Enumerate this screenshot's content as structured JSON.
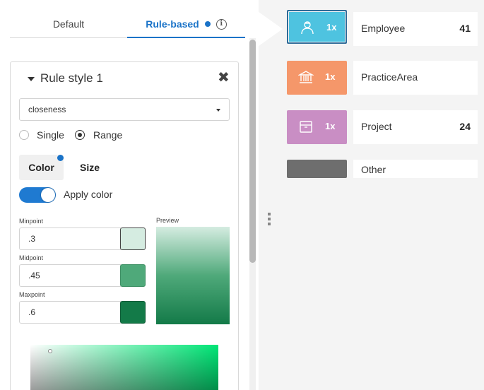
{
  "tabs": [
    {
      "label": "Default"
    },
    {
      "label": "Rule-based"
    }
  ],
  "rule": {
    "title": "Rule style 1",
    "property": "closeness",
    "mode_options": [
      "Single",
      "Range"
    ],
    "mode_selected": "Range",
    "subtabs": [
      "Color",
      "Size"
    ],
    "active_subtab": "Color",
    "apply_color_label": "Apply color",
    "apply_color_on": true,
    "minpoint_label": "Minpoint",
    "minpoint_value": ".3",
    "minpoint_color": "#d5ece1",
    "midpoint_label": "Midpoint",
    "midpoint_value": ".45",
    "midpoint_color": "#4fa97a",
    "maxpoint_label": "Maxpoint",
    "maxpoint_value": ".6",
    "maxpoint_color": "#137a48",
    "preview_label": "Preview"
  },
  "colors": {
    "accent": "#1a73c8",
    "toggle": "#1f7ad1"
  },
  "categories": [
    {
      "name": "Employee",
      "multiplier": "1x",
      "count": "41",
      "color": "#4ec3e0",
      "icon": "user-icon",
      "selected": true
    },
    {
      "name": "PracticeArea",
      "multiplier": "1x",
      "count": "",
      "color": "#f5976a",
      "icon": "bank-icon",
      "selected": false
    },
    {
      "name": "Project",
      "multiplier": "1x",
      "count": "24",
      "color": "#c98ec4",
      "icon": "box-icon",
      "selected": false
    },
    {
      "name": "Other",
      "multiplier": "",
      "count": "",
      "color": "#6e6e6e",
      "icon": "",
      "selected": false
    }
  ]
}
